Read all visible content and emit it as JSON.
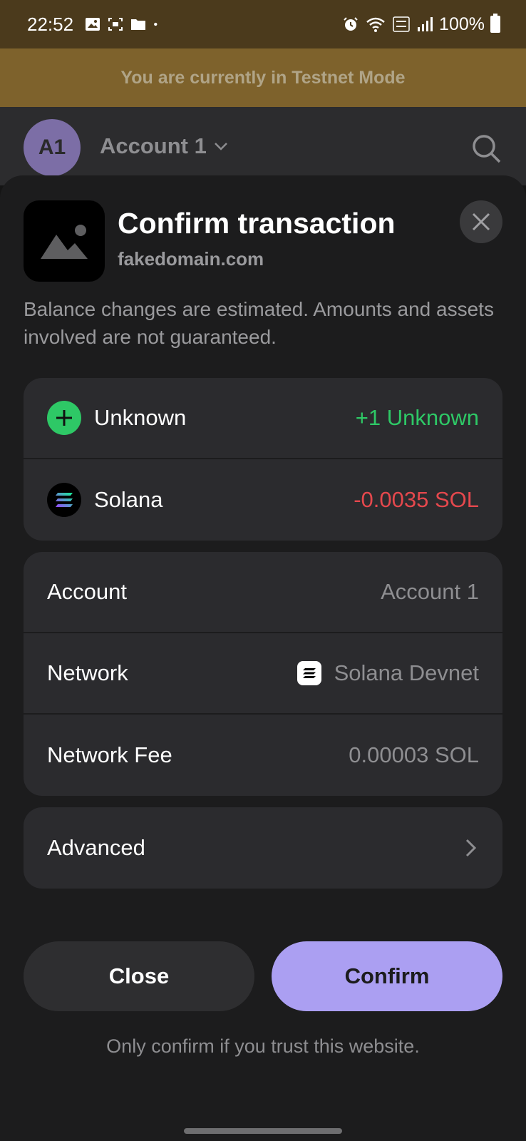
{
  "status_bar": {
    "time": "22:52",
    "battery": "100%"
  },
  "banner": {
    "text": "You are currently in Testnet Mode"
  },
  "header": {
    "avatar": "A1",
    "account_name": "Account 1"
  },
  "dialog": {
    "title": "Confirm transaction",
    "domain": "fakedomain.com",
    "disclaimer": "Balance changes are estimated. Amounts and assets involved are not guaranteed."
  },
  "balance_changes": [
    {
      "label": "Unknown",
      "value": "+1 Unknown",
      "icon": "plus-icon",
      "color": "#2ec866"
    },
    {
      "label": "Solana",
      "value": "-0.0035 SOL",
      "icon": "solana-icon",
      "color": "#e5484d"
    }
  ],
  "details": {
    "account_label": "Account",
    "account_value": "Account 1",
    "network_label": "Network",
    "network_value": "Solana Devnet",
    "fee_label": "Network Fee",
    "fee_value": "0.00003 SOL"
  },
  "advanced": {
    "label": "Advanced"
  },
  "buttons": {
    "close": "Close",
    "confirm": "Confirm"
  },
  "footer_note": "Only confirm if you trust this website.",
  "colors": {
    "accent": "#ab9ff2",
    "positive": "#2ec866",
    "negative": "#e5484d",
    "testnet_banner": "#7e622c"
  }
}
